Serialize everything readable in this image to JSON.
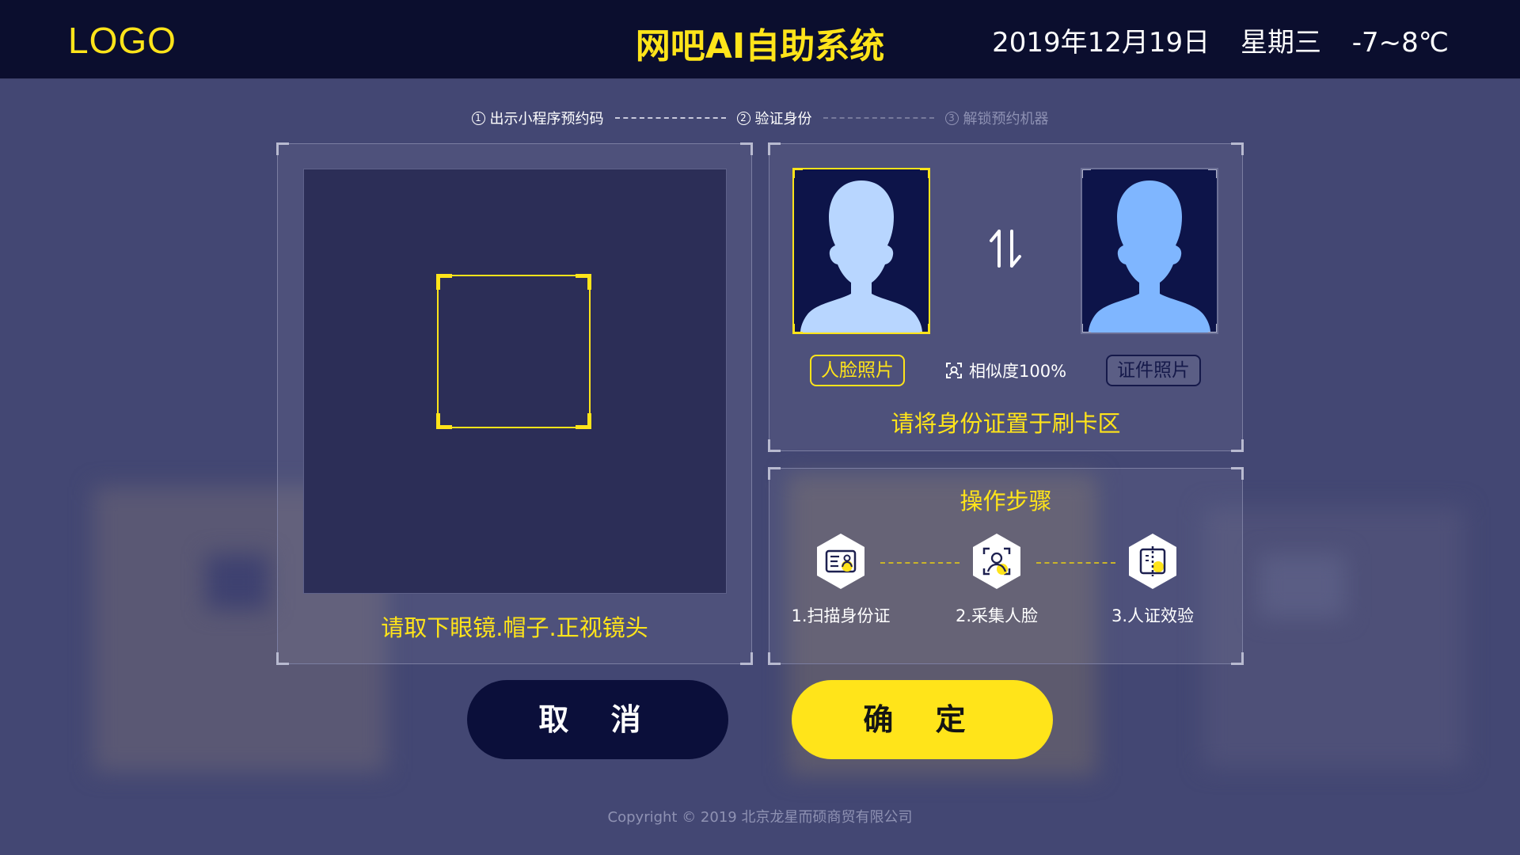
{
  "header": {
    "logo": "LOGO",
    "title": "网吧AI自助系统",
    "date": "2019年12月19日",
    "weekday": "星期三",
    "temperature": "-7~8℃"
  },
  "stepper": {
    "steps": [
      {
        "num": "1",
        "label": "出示小程序预约码",
        "state": "done"
      },
      {
        "num": "2",
        "label": "验证身份",
        "state": "current"
      },
      {
        "num": "3",
        "label": "解锁预约机器",
        "state": "pending"
      }
    ]
  },
  "camera": {
    "hint": "请取下眼镜.帽子.正视镜头"
  },
  "compare": {
    "face_label": "人脸照片",
    "id_label": "证件照片",
    "similarity": "相似度100%",
    "card_hint": "请将身份证置于刷卡区"
  },
  "operation": {
    "title": "操作步骤",
    "steps": [
      {
        "label": "1.扫描身份证",
        "icon": "id-card-icon"
      },
      {
        "label": "2.采集人脸",
        "icon": "face-scan-icon"
      },
      {
        "label": "3.人证效验",
        "icon": "verify-icon"
      }
    ]
  },
  "buttons": {
    "cancel": "取 消",
    "confirm": "确 定"
  },
  "footer": {
    "copyright": "Copyright © 2019  北京龙星而硕商贸有限公司"
  },
  "colors": {
    "accent": "#ffe41a",
    "header_bg": "#0b0e2e",
    "page_bg": "#434773",
    "cancel_bg": "#0b0f3a"
  }
}
